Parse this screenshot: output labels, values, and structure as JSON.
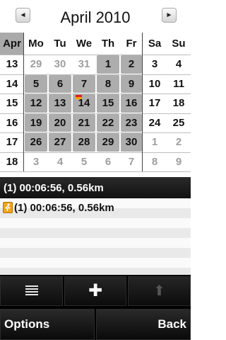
{
  "header": {
    "month_title": "April 2010",
    "prev_icon": "◄",
    "next_icon": "►"
  },
  "calendar": {
    "corner_label": "Apr",
    "day_names": [
      "Mo",
      "Tu",
      "We",
      "Th",
      "Fr",
      "Sa",
      "Su"
    ],
    "weeks": [
      {
        "week": "13",
        "days": [
          "29",
          "30",
          "31",
          "1",
          "2",
          "3",
          "4"
        ]
      },
      {
        "week": "14",
        "days": [
          "5",
          "6",
          "7",
          "8",
          "9",
          "10",
          "11"
        ]
      },
      {
        "week": "15",
        "days": [
          "12",
          "13",
          "14",
          "15",
          "16",
          "17",
          "18"
        ]
      },
      {
        "week": "16",
        "days": [
          "19",
          "20",
          "21",
          "22",
          "23",
          "24",
          "25"
        ]
      },
      {
        "week": "17",
        "days": [
          "26",
          "27",
          "28",
          "29",
          "30",
          "1",
          "2"
        ]
      },
      {
        "week": "18",
        "days": [
          "3",
          "4",
          "5",
          "6",
          "7",
          "8",
          "9"
        ]
      }
    ],
    "today_marker_colors": [
      "#e0201e",
      "#f5a000"
    ]
  },
  "entries": {
    "highlighted": "(1) 00:06:56, 0.56km",
    "items": [
      {
        "icon": "running-person-icon",
        "text": "(1) 00:06:56, 0.56km"
      }
    ]
  },
  "toolbar": {
    "buttons": [
      "list-icon",
      "plus-icon",
      "up-arrow-icon"
    ],
    "plus_glyph": "✚",
    "up_glyph": "⬆"
  },
  "softkeys": {
    "left": "Options",
    "right": "Back"
  }
}
